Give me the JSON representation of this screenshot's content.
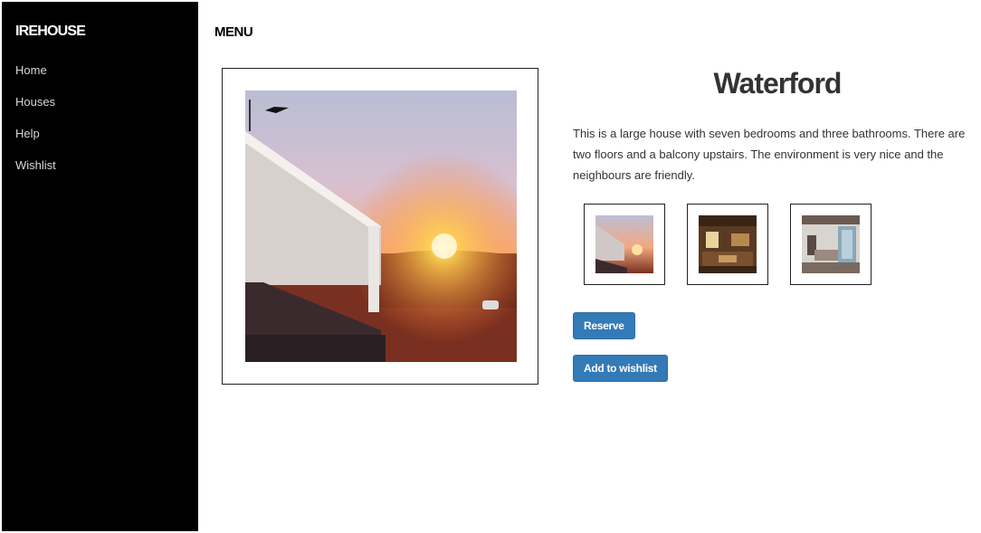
{
  "sidebar": {
    "brand": "IREHOUSE",
    "items": [
      {
        "label": "Home"
      },
      {
        "label": "Houses"
      },
      {
        "label": "Help"
      },
      {
        "label": "Wishlist"
      }
    ]
  },
  "header": {
    "menu_label": "MENU"
  },
  "listing": {
    "title": "Waterford",
    "description": "This is a large house with seven bedrooms and three bathrooms. There are two floors and a balcony upstairs. The environment is very nice and the neighbours are friendly.",
    "main_image": "sunset-house-photo",
    "thumbnails": [
      {
        "image": "sunset-house-photo"
      },
      {
        "image": "living-room-photo"
      },
      {
        "image": "interior-room-photo"
      }
    ]
  },
  "actions": {
    "reserve_label": "Reserve",
    "wishlist_label": "Add to wishlist"
  },
  "colors": {
    "sidebar_bg": "#000000",
    "button_bg": "#337ab7",
    "text": "#333333"
  }
}
